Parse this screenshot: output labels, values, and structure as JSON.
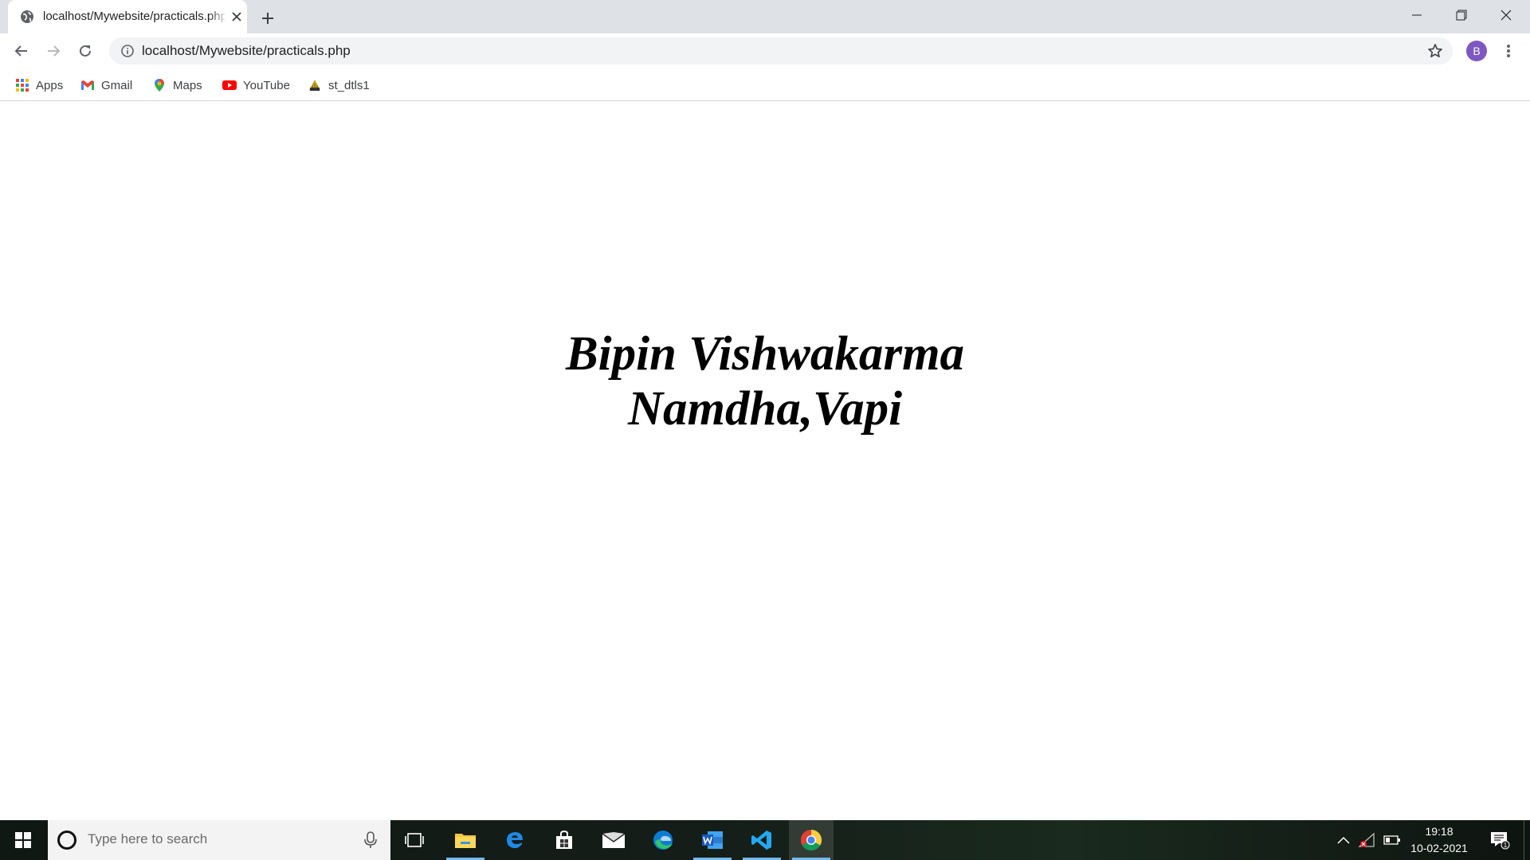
{
  "browser": {
    "tab_title": "localhost/Mywebsite/practicals.php",
    "url": "localhost/Mywebsite/practicals.php",
    "profile_initial": "B",
    "profile_color": "#7e57c2",
    "bookmarks": [
      {
        "label": "Apps",
        "icon": "apps-grid-icon"
      },
      {
        "label": "Gmail",
        "icon": "gmail-icon"
      },
      {
        "label": "Maps",
        "icon": "maps-pin-icon"
      },
      {
        "label": "YouTube",
        "icon": "youtube-icon"
      },
      {
        "label": "st_dtls1",
        "icon": "site-favicon-icon"
      }
    ]
  },
  "page": {
    "line1": "Bipin Vishwakarma",
    "line2": "Namdha,Vapi"
  },
  "taskbar": {
    "search_placeholder": "Type here to search",
    "apps": [
      "task-view",
      "file-explorer",
      "edge-legacy",
      "microsoft-store",
      "mail",
      "edge",
      "word",
      "vscode",
      "chrome"
    ],
    "time": "19:18",
    "date": "10-02-2021",
    "notification_count": "1"
  }
}
